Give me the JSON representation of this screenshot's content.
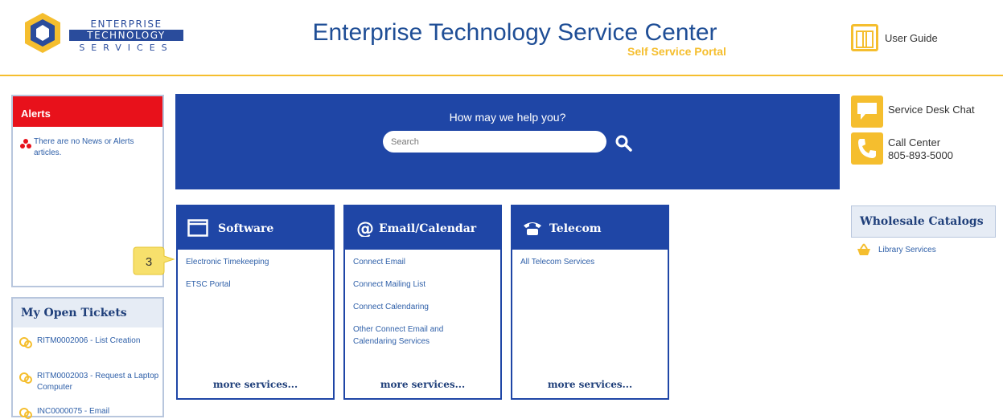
{
  "header": {
    "logo": {
      "line1": "ENTERPRISE",
      "line2": "TECHNOLOGY",
      "line3": "SERVICES"
    },
    "title": "Enterprise Technology Service Center",
    "subtitle": "Self Service Portal",
    "user_guide_label": "User Guide"
  },
  "colors": {
    "accent": "#f5be2e",
    "brand_blue": "#1f46a6",
    "alert_red": "#e8111b"
  },
  "alerts": {
    "title": "Alerts",
    "message": "There are no News or Alerts articles."
  },
  "tickets": {
    "title": "My Open Tickets",
    "items": [
      "RITM0002006 - List Creation",
      "RITM0002003 - Request a Laptop Computer",
      "INC0000075 - Email"
    ]
  },
  "search": {
    "prompt": "How may we help you?",
    "placeholder": "Search"
  },
  "cards": [
    {
      "title": "Software",
      "icon": "window-icon",
      "links": [
        "Electronic Timekeeping",
        "ETSC Portal"
      ],
      "more": "more services..."
    },
    {
      "title": "Email/Calendar",
      "icon": "at-sign-icon",
      "links": [
        "Connect Email",
        "Connect Mailing List",
        "Connect Calendaring",
        "Other Connect Email and Calendaring Services"
      ],
      "more": "more services..."
    },
    {
      "title": "Telecom",
      "icon": "telephone-icon",
      "links": [
        "All Telecom Services"
      ],
      "more": "more services..."
    }
  ],
  "callout": {
    "number": "3"
  },
  "right": {
    "chat_label": "Service Desk Chat",
    "call_title": "Call Center",
    "call_number": "805-893-5000",
    "catalog_title": "Wholesale Catalogs",
    "catalog_items": [
      "Library Services"
    ]
  }
}
